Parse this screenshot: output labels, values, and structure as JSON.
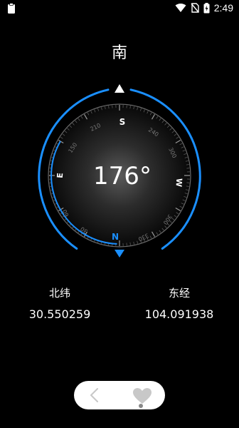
{
  "status_bar": {
    "time": "2:49",
    "icons": [
      "clipboard-icon",
      "wifi-icon",
      "no-sim-icon",
      "battery-charging-icon"
    ]
  },
  "compass": {
    "direction_label": "南",
    "heading_degrees": "176°",
    "cardinals": {
      "n": "N",
      "e": "E",
      "s": "S",
      "w": "W"
    },
    "ticks": [
      "30",
      "60",
      "120",
      "150",
      "210",
      "240",
      "300",
      "330"
    ],
    "accent_color": "#1a8fff"
  },
  "location": {
    "latitude_label": "北纬",
    "latitude_value": "30.550259",
    "longitude_label": "东经",
    "longitude_value": "104.091938"
  },
  "bottom_bar": {
    "icons": [
      "back-icon",
      "heart-icon"
    ]
  }
}
